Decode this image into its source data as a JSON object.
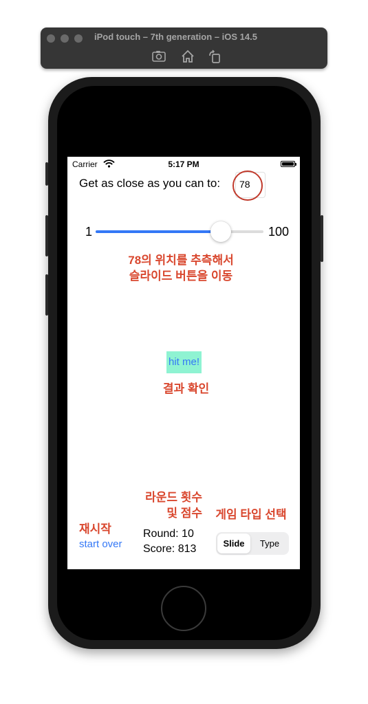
{
  "simulator": {
    "title": "iPod touch – 7th generation – iOS 14.5",
    "toolbar_icons": [
      "screenshot-icon",
      "home-icon",
      "rotate-icon"
    ]
  },
  "status_bar": {
    "carrier": "Carrier",
    "time": "5:17 PM"
  },
  "game": {
    "prompt": "Get as close as you can to:",
    "target_value": "78",
    "slider": {
      "min_label": "1",
      "max_label": "100",
      "min": 1,
      "max": 100,
      "value": 75
    },
    "hit_button_label": "hit me!",
    "start_over_label": "start over",
    "round_label": "Round: 10",
    "score_label": "Score: 813",
    "game_type": {
      "options": [
        "Slide",
        "Type"
      ],
      "selected": "Slide"
    }
  },
  "annotations": {
    "slider_note_line1": "78의 위치를 추측해서",
    "slider_note_line2": "슬라이드 버튼을 이동",
    "hit_note": "결과 확인",
    "round_note_line1": "라운드 횟수",
    "round_note_line2": "및 점수",
    "restart_note": "재시작",
    "type_note": "게임 타입 선택"
  },
  "colors": {
    "annotation": "#d9472e",
    "accent": "#3478f6",
    "hit_button_bg": "#8ff3d2"
  }
}
